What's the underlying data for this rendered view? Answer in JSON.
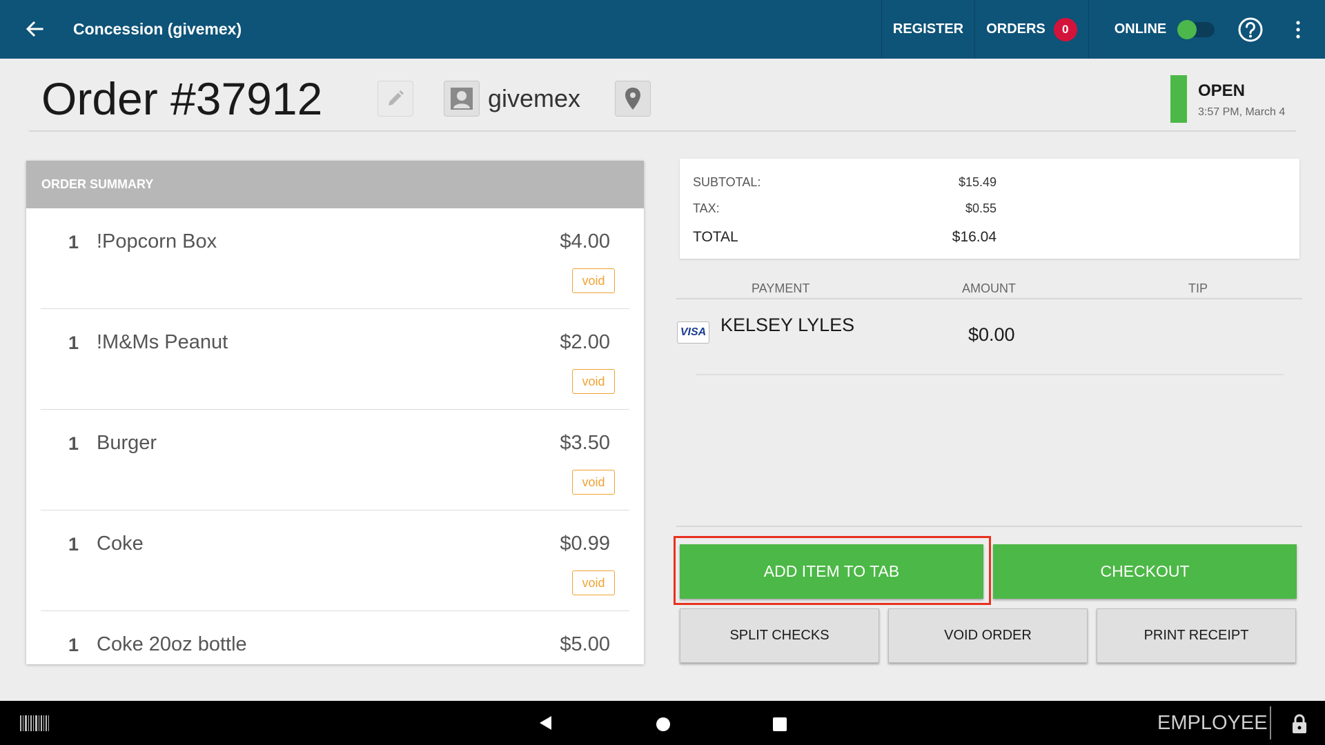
{
  "topbar": {
    "title": "Concession (givemex)",
    "register_label": "REGISTER",
    "orders_label": "ORDERS",
    "orders_count": "0",
    "online_label": "ONLINE",
    "online_toggle_on": true,
    "icons": {
      "back": "arrow-left-icon",
      "help": "question-circle-icon",
      "menu": "kebab-menu-icon"
    },
    "colors": {
      "background": "#0e5378",
      "badge": "#d4133a",
      "toggle_knob": "#4cb84c"
    }
  },
  "header": {
    "order_title": "Order #37912",
    "customer_name": "givemex",
    "status": "OPEN",
    "status_time": "3:57 PM, March 4",
    "status_color": "#4cb847",
    "icons": {
      "edit": "pencil-icon",
      "customer": "user-avatar-icon",
      "location": "map-pin-icon"
    }
  },
  "summary": {
    "heading": "ORDER SUMMARY",
    "void_label": "void",
    "items": [
      {
        "qty": "1",
        "name": "!Popcorn Box",
        "price": "$4.00"
      },
      {
        "qty": "1",
        "name": "!M&Ms Peanut",
        "price": "$2.00"
      },
      {
        "qty": "1",
        "name": "Burger",
        "price": "$3.50"
      },
      {
        "qty": "1",
        "name": "Coke",
        "price": "$0.99"
      },
      {
        "qty": "1",
        "name": "Coke 20oz bottle",
        "price": "$5.00"
      }
    ]
  },
  "totals": {
    "subtotal_label": "SUBTOTAL:",
    "subtotal_value": "$15.49",
    "tax_label": "TAX:",
    "tax_value": "$0.55",
    "total_label": "TOTAL",
    "total_value": "$16.04"
  },
  "payments": {
    "headers": {
      "payment": "PAYMENT",
      "amount": "AMOUNT",
      "tip": "TIP"
    },
    "rows": [
      {
        "card_brand": "VISA",
        "payer": "KELSEY LYLES",
        "amount": "$0.00",
        "tip": ""
      }
    ]
  },
  "actions": {
    "add_item": "ADD ITEM TO TAB",
    "checkout": "CHECKOUT",
    "split_checks": "SPLIT CHECKS",
    "void_order": "VOID ORDER",
    "print_receipt": "PRINT RECEIPT",
    "primary_color": "#4cb847",
    "highlight_color": "#e8311f"
  },
  "bottombar": {
    "employee_label": "EMPLOYEE",
    "icons": {
      "barcode": "barcode-icon",
      "back": "nav-back-icon",
      "home": "nav-home-icon",
      "recent": "nav-recent-icon",
      "lock": "lock-icon"
    }
  }
}
